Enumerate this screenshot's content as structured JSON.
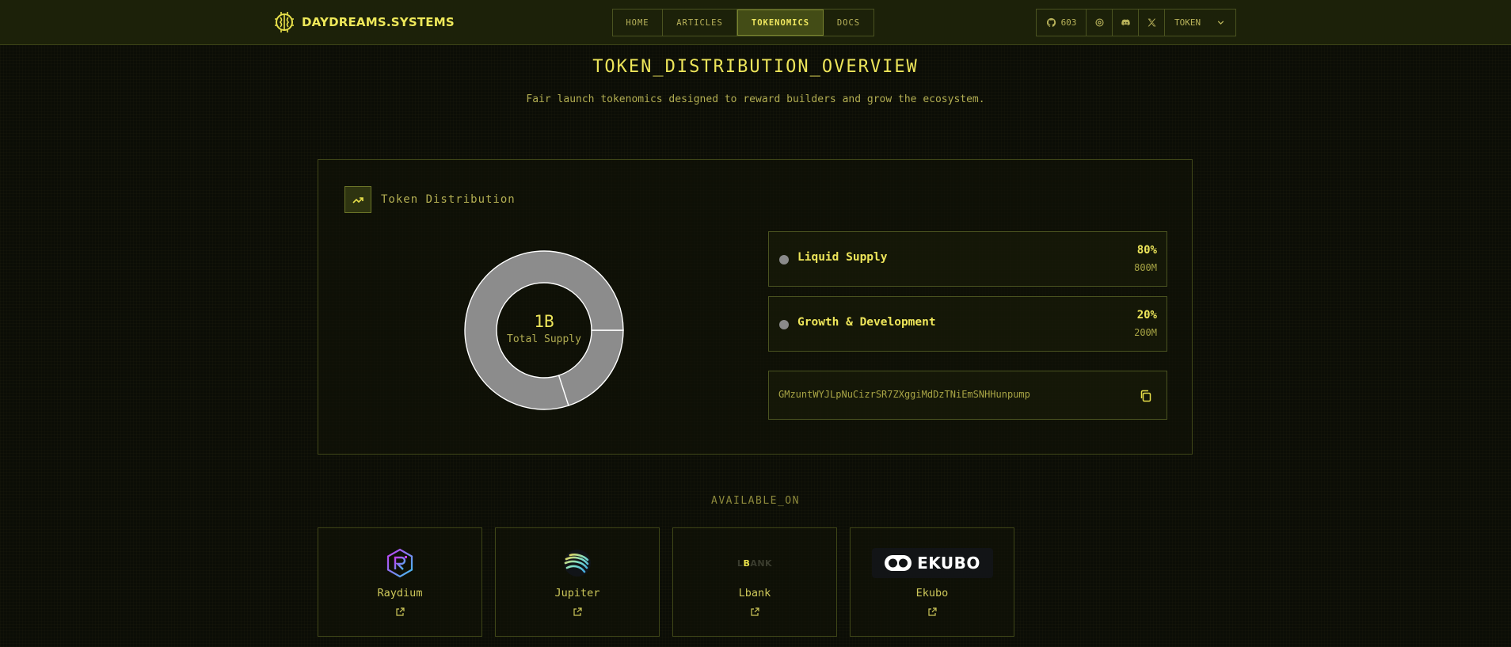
{
  "nav": {
    "brand": "DAYDREAMS.SYSTEMS",
    "tabs": [
      {
        "label": "HOME",
        "active": false
      },
      {
        "label": "ARTICLES",
        "active": false
      },
      {
        "label": "TOKENOMICS",
        "active": true
      },
      {
        "label": "DOCS",
        "active": false
      }
    ],
    "github_stars": "603",
    "token_menu_label": "TOKEN"
  },
  "hero": {
    "title": "TOKEN_DISTRIBUTION_OVERVIEW",
    "subtitle": "Fair launch tokenomics designed to reward builders and grow the ecosystem."
  },
  "distribution": {
    "card_title": "Token Distribution",
    "total_value": "1B",
    "total_label": "Total Supply",
    "contract_address": "GMzuntWYJLpNuCizrSR7ZXggiMdDzTNiEmSNHHunpump"
  },
  "chart_data": {
    "type": "pie",
    "categories": [
      "Liquid Supply",
      "Growth & Development"
    ],
    "values": [
      80,
      20
    ],
    "amounts": [
      "800M",
      "200M"
    ],
    "percent_labels": [
      "80%",
      "20%"
    ],
    "colors": [
      "#8c8c8c",
      "#8c8c8c"
    ]
  },
  "available_on": {
    "title": "AVAILABLE_ON",
    "exchanges": [
      {
        "name": "Raydium"
      },
      {
        "name": "Jupiter"
      },
      {
        "name": "Lbank",
        "logo_text_lead": "L",
        "logo_text_accent": "B",
        "logo_text_tail": "ANK"
      },
      {
        "name": "Ekubo",
        "logo_text": "EKUBO"
      }
    ]
  },
  "colors": {
    "accent": "#e8e04a",
    "background": "#0b0d06",
    "navbar": "#1c2109",
    "border": "#4a5320",
    "slice": "#8c8c8c"
  }
}
